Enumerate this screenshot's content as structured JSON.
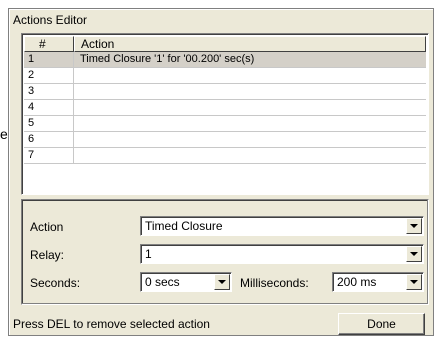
{
  "background_glyph": "e.",
  "window": {
    "title": "Actions Editor"
  },
  "table": {
    "columns": [
      "#",
      "Action"
    ],
    "rows": [
      {
        "num": "1",
        "action": "Timed Closure '1' for '00.200' sec(s)"
      },
      {
        "num": "2",
        "action": ""
      },
      {
        "num": "3",
        "action": ""
      },
      {
        "num": "4",
        "action": ""
      },
      {
        "num": "5",
        "action": ""
      },
      {
        "num": "6",
        "action": ""
      },
      {
        "num": "7",
        "action": ""
      }
    ]
  },
  "form": {
    "action_label": "Action",
    "action_value": "Timed Closure",
    "relay_label": "Relay:",
    "relay_value": "1",
    "seconds_label": "Seconds:",
    "seconds_value": "0 secs",
    "ms_label": "Milliseconds:",
    "ms_value": "200 ms"
  },
  "status": "Press DEL to remove selected action",
  "done_label": "Done",
  "icons": {
    "dropdown": "chevron-down-icon"
  }
}
